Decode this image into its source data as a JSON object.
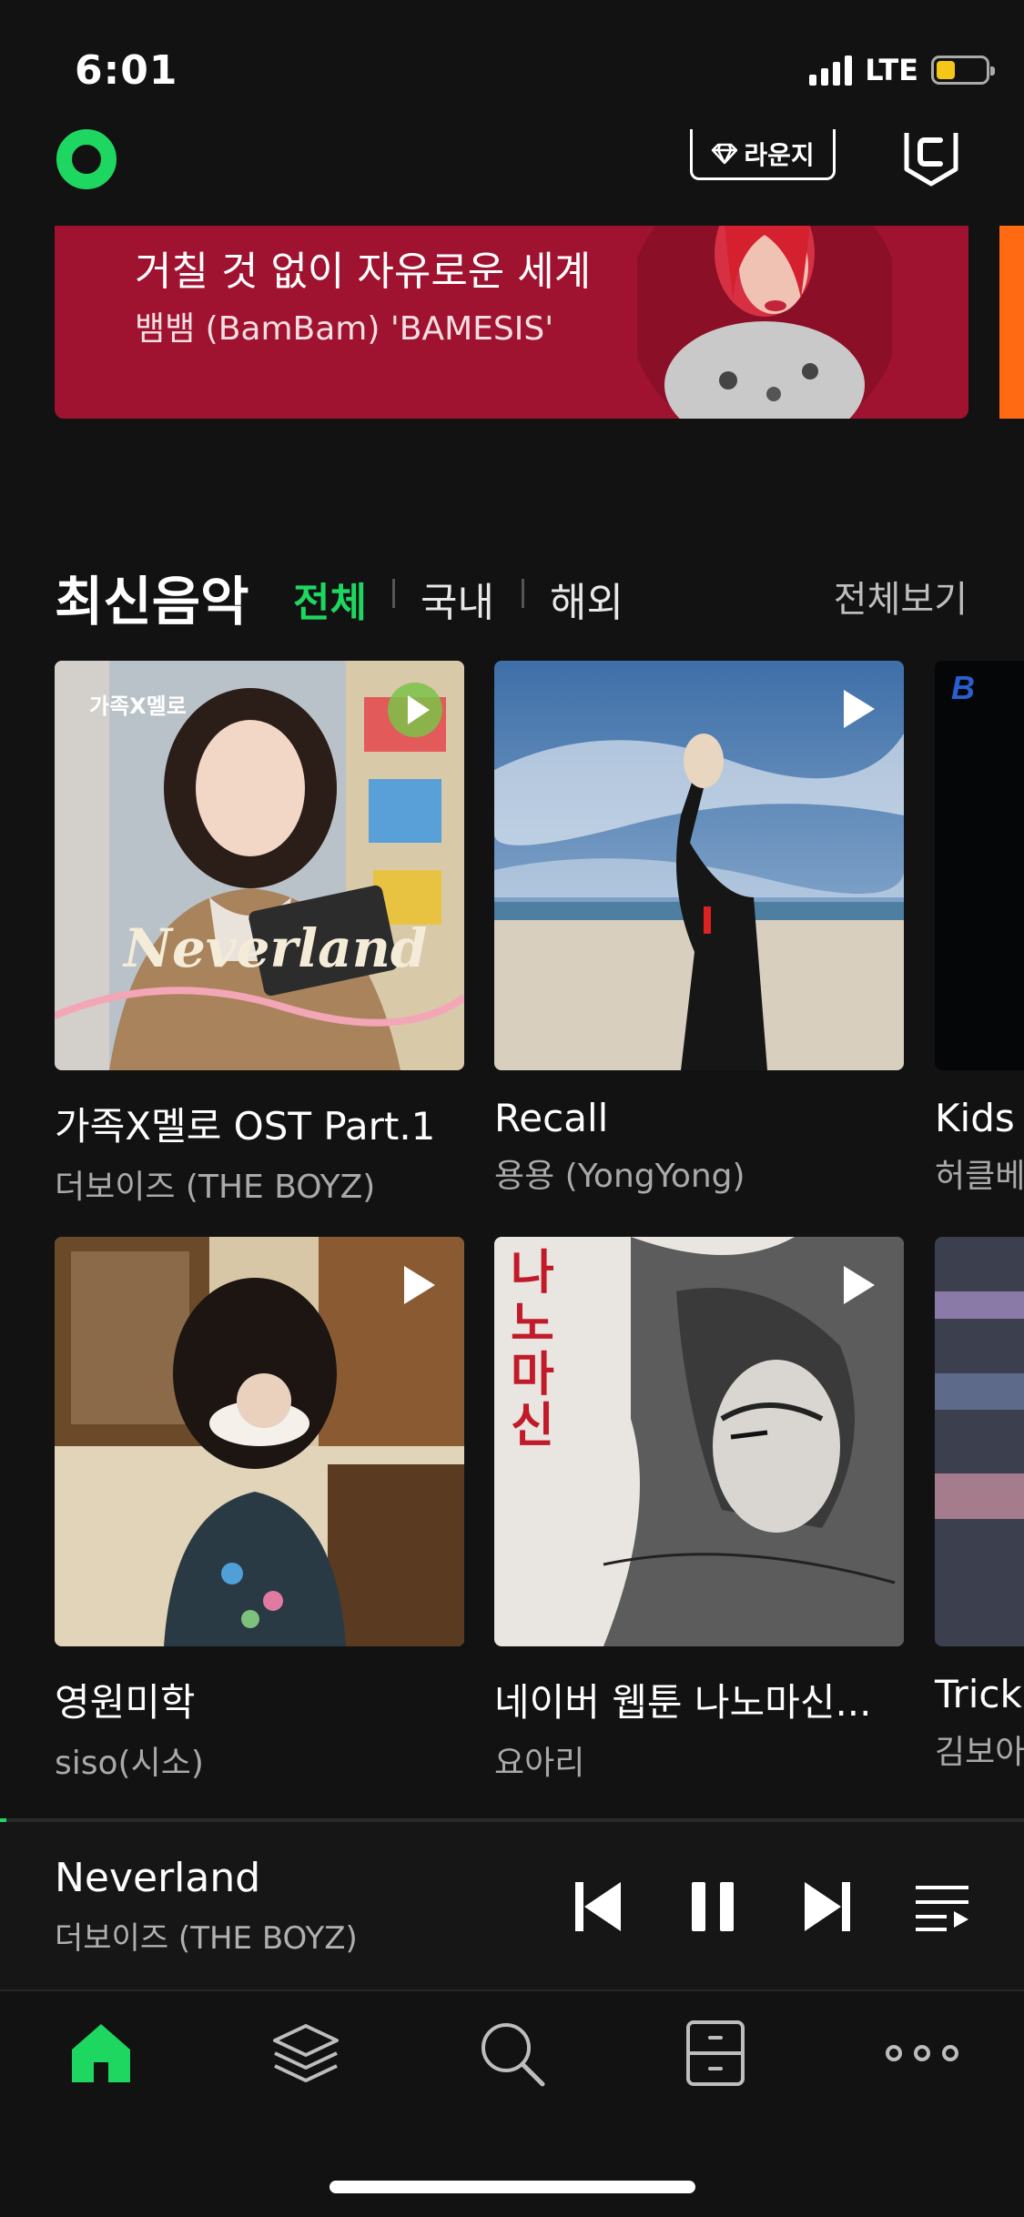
{
  "status_bar": {
    "time": "6:01",
    "network": "LTE",
    "battery_level": 0.38
  },
  "header": {
    "logo_icon": "melon-logo-icon",
    "lounge_label": "라운지",
    "lounge_icon": "diamond-icon",
    "coupon_icon": "c-shield-icon"
  },
  "banner": {
    "title": "거칠 것 없이 자유로운 세계",
    "subtitle": "뱀뱀 (BamBam) 'BAMESIS'",
    "color": "#a01330"
  },
  "section": {
    "title": "최신음악",
    "tabs": [
      {
        "label": "전체",
        "active": true
      },
      {
        "label": "국내",
        "active": false
      },
      {
        "label": "해외",
        "active": false
      }
    ],
    "see_all": "전체보기"
  },
  "albums": [
    {
      "title": "가족X멜로 OST Part.1",
      "artist": "더보이즈 (THE BOYZ)",
      "cover_text": "Neverland",
      "badge": "가족X멜로"
    },
    {
      "title": "Recall",
      "artist": "용용 (YongYong)"
    },
    {
      "title": "Kids",
      "artist": "허클베"
    },
    {
      "title": "영원미학",
      "artist": "siso(시소)"
    },
    {
      "title": "네이버 웹툰 나노마신...",
      "artist": "요아리",
      "cover_text": "나노마신"
    },
    {
      "title": "Trick",
      "artist": "김보아"
    }
  ],
  "now_playing": {
    "title": "Neverland",
    "artist": "더보이즈 (THE BOYZ)",
    "progress": 0.006,
    "state": "playing"
  },
  "tab_bar": [
    {
      "name": "home-icon",
      "active": true
    },
    {
      "name": "layers-icon",
      "active": false
    },
    {
      "name": "search-icon",
      "active": false
    },
    {
      "name": "library-icon",
      "active": false
    },
    {
      "name": "more-icon",
      "active": false
    }
  ],
  "colors": {
    "accent": "#1ed760",
    "background": "#121212",
    "banner": "#a01330",
    "next_banner": "#ff6a13"
  }
}
